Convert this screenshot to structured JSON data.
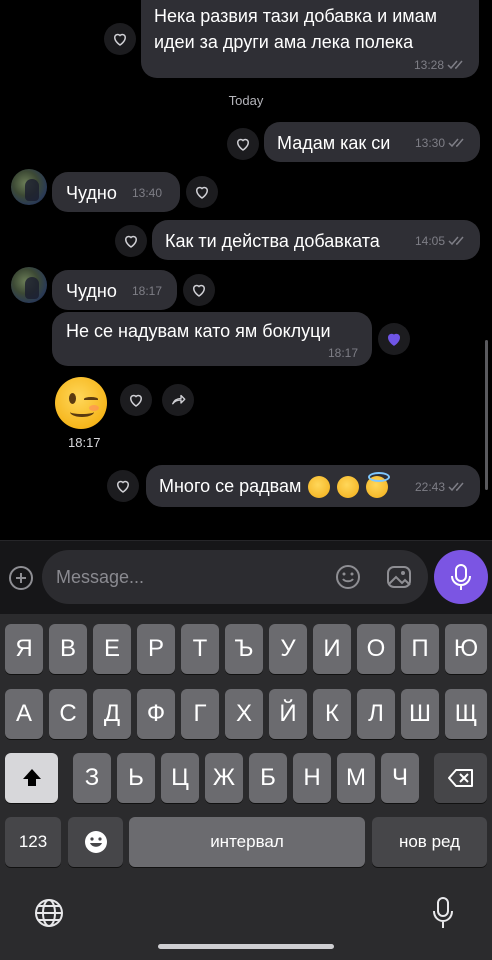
{
  "colors": {
    "background": "#000000",
    "bubble": "#2f2f35",
    "accent": "#7b55e3",
    "meta_text": "#7e7e86",
    "liked_heart": "#6f55e6"
  },
  "messages": {
    "m1": {
      "line1": "Нека развия тази добавка и имам",
      "line2": "идеи за други ама лека полека",
      "time": "13:28",
      "direction": "outgoing"
    },
    "date_separator": "Today",
    "m2": {
      "text": "Мадам как си",
      "time": "13:30",
      "direction": "outgoing"
    },
    "m3": {
      "text": "Чудно",
      "time": "13:40",
      "direction": "incoming"
    },
    "m4": {
      "text": "Как ти действа добавката",
      "time": "14:05",
      "direction": "outgoing"
    },
    "m5": {
      "text": "Чудно",
      "time": "18:17",
      "direction": "incoming"
    },
    "m6": {
      "text": "Не се надувам като ям боклуци",
      "time": "18:17",
      "direction": "incoming",
      "liked": true
    },
    "m7": {
      "emoji": "winking-face",
      "time": "18:17",
      "direction": "incoming"
    },
    "m8": {
      "text": "Много се радвам",
      "emojis": [
        "squinting-tongue-face",
        "winking-face",
        "smiling-halo-face"
      ],
      "time": "22:43",
      "direction": "outgoing"
    }
  },
  "composer": {
    "placeholder": "Message...",
    "icons": [
      "plus-icon",
      "smiley-icon",
      "gallery-icon",
      "microphone-icon"
    ]
  },
  "keyboard": {
    "row1": [
      "Я",
      "В",
      "Е",
      "Р",
      "Т",
      "Ъ",
      "У",
      "И",
      "О",
      "П",
      "Ю"
    ],
    "row2": [
      "А",
      "С",
      "Д",
      "Ф",
      "Г",
      "Х",
      "Й",
      "К",
      "Л",
      "Ш",
      "Щ"
    ],
    "row3": [
      "З",
      "Ь",
      "Ц",
      "Ж",
      "Б",
      "Н",
      "М",
      "Ч"
    ],
    "numbers_key": "123",
    "space_key": "интервал",
    "return_key": "нов ред"
  }
}
